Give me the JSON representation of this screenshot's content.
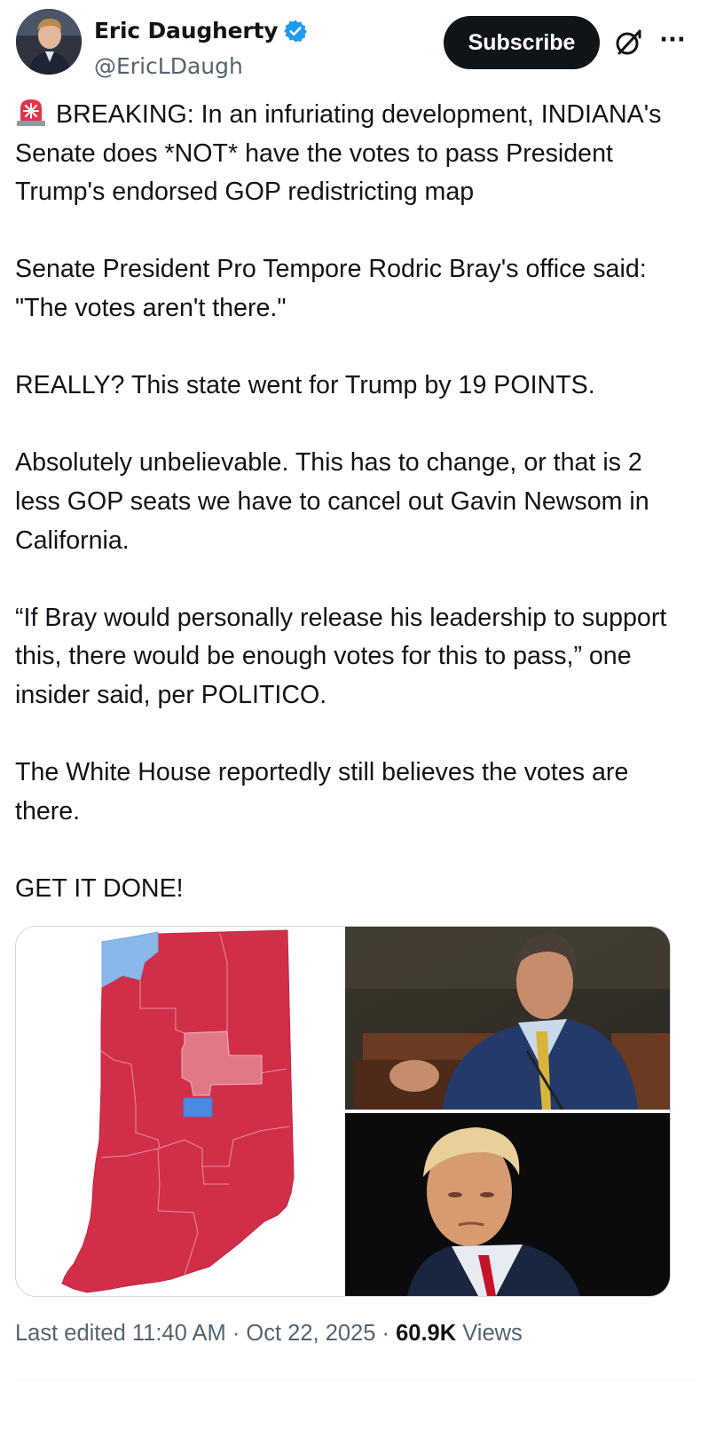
{
  "author": {
    "display_name": "Eric Daugherty",
    "handle": "@EricLDaugh",
    "verified_icon": "verified-badge-icon"
  },
  "header": {
    "subscribe_label": "Subscribe",
    "grok_icon": "grok-icon",
    "more_icon": "more-icon",
    "more_glyph": "···"
  },
  "post": {
    "emoji": "siren-emoji",
    "paragraphs": [
      "BREAKING: In an infuriating development, INDIANA's Senate does *NOT* have the votes to pass President Trump's endorsed GOP redistricting map",
      "Senate President Pro Tempore Rodric Bray's office said: \"The votes aren't there.\"",
      "REALLY? This state went for Trump by 19 POINTS.",
      "Absolutely unbelievable. This has to change, or that is 2 less GOP seats we have to cancel out Gavin Newsom in California.",
      "“If Bray would personally release his leadership to support this, there would be enough votes for this to pass,” one insider said, per POLITICO.",
      "The White House reportedly still believes the votes are there.",
      "GET IT DONE!"
    ]
  },
  "media": {
    "map_image": "indiana-congressional-district-map",
    "top_photo": "man-in-suit-speaking-photo",
    "bottom_photo": "trump-portrait-photo",
    "colors": {
      "red": "#d12e4a",
      "light_red": "#e17888",
      "light_blue": "#8ab8ea",
      "blue": "#4a8ae0"
    }
  },
  "footer": {
    "edited_prefix": "Last edited",
    "time": "11:40 AM",
    "separator": "·",
    "date": "Oct 22, 2025",
    "views_count": "60.9K",
    "views_label": "Views"
  }
}
